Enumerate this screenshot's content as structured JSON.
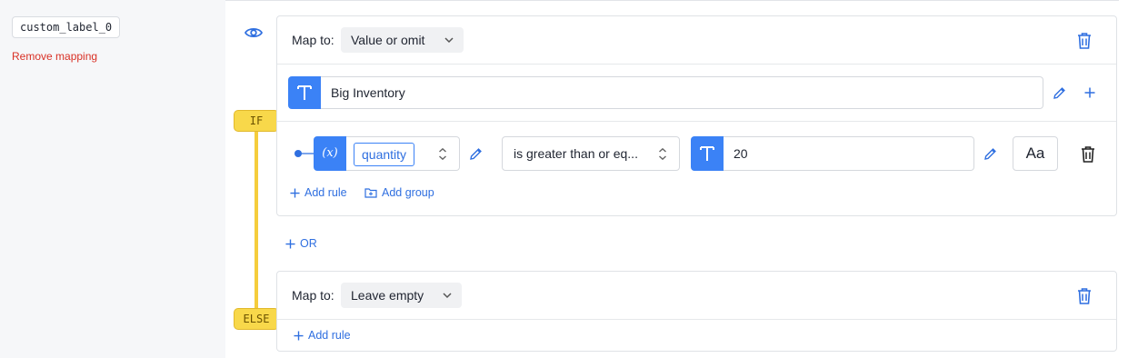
{
  "mapping": {
    "field_name": "custom_label_0",
    "remove_label": "Remove mapping"
  },
  "condition": {
    "if_tag": "IF",
    "else_tag": "ELSE"
  },
  "if_block": {
    "map_to_label": "Map to:",
    "map_to_value": "Value or omit",
    "output_text": "Big Inventory",
    "rule": {
      "variable_icon": "(x)",
      "variable": "quantity",
      "operator": "is greater than or eq...",
      "value": "20",
      "text_mode_label": "Aa"
    },
    "add_rule_label": "Add rule",
    "add_group_label": "Add group"
  },
  "or_label": "OR",
  "else_block": {
    "map_to_label": "Map to:",
    "map_to_value": "Leave empty",
    "add_rule_label": "Add rule"
  },
  "colors": {
    "accent_blue": "#3b82f6",
    "link_blue": "#2f6fe0",
    "danger_red": "#d93025",
    "condition_yellow": "#f8d84a"
  }
}
